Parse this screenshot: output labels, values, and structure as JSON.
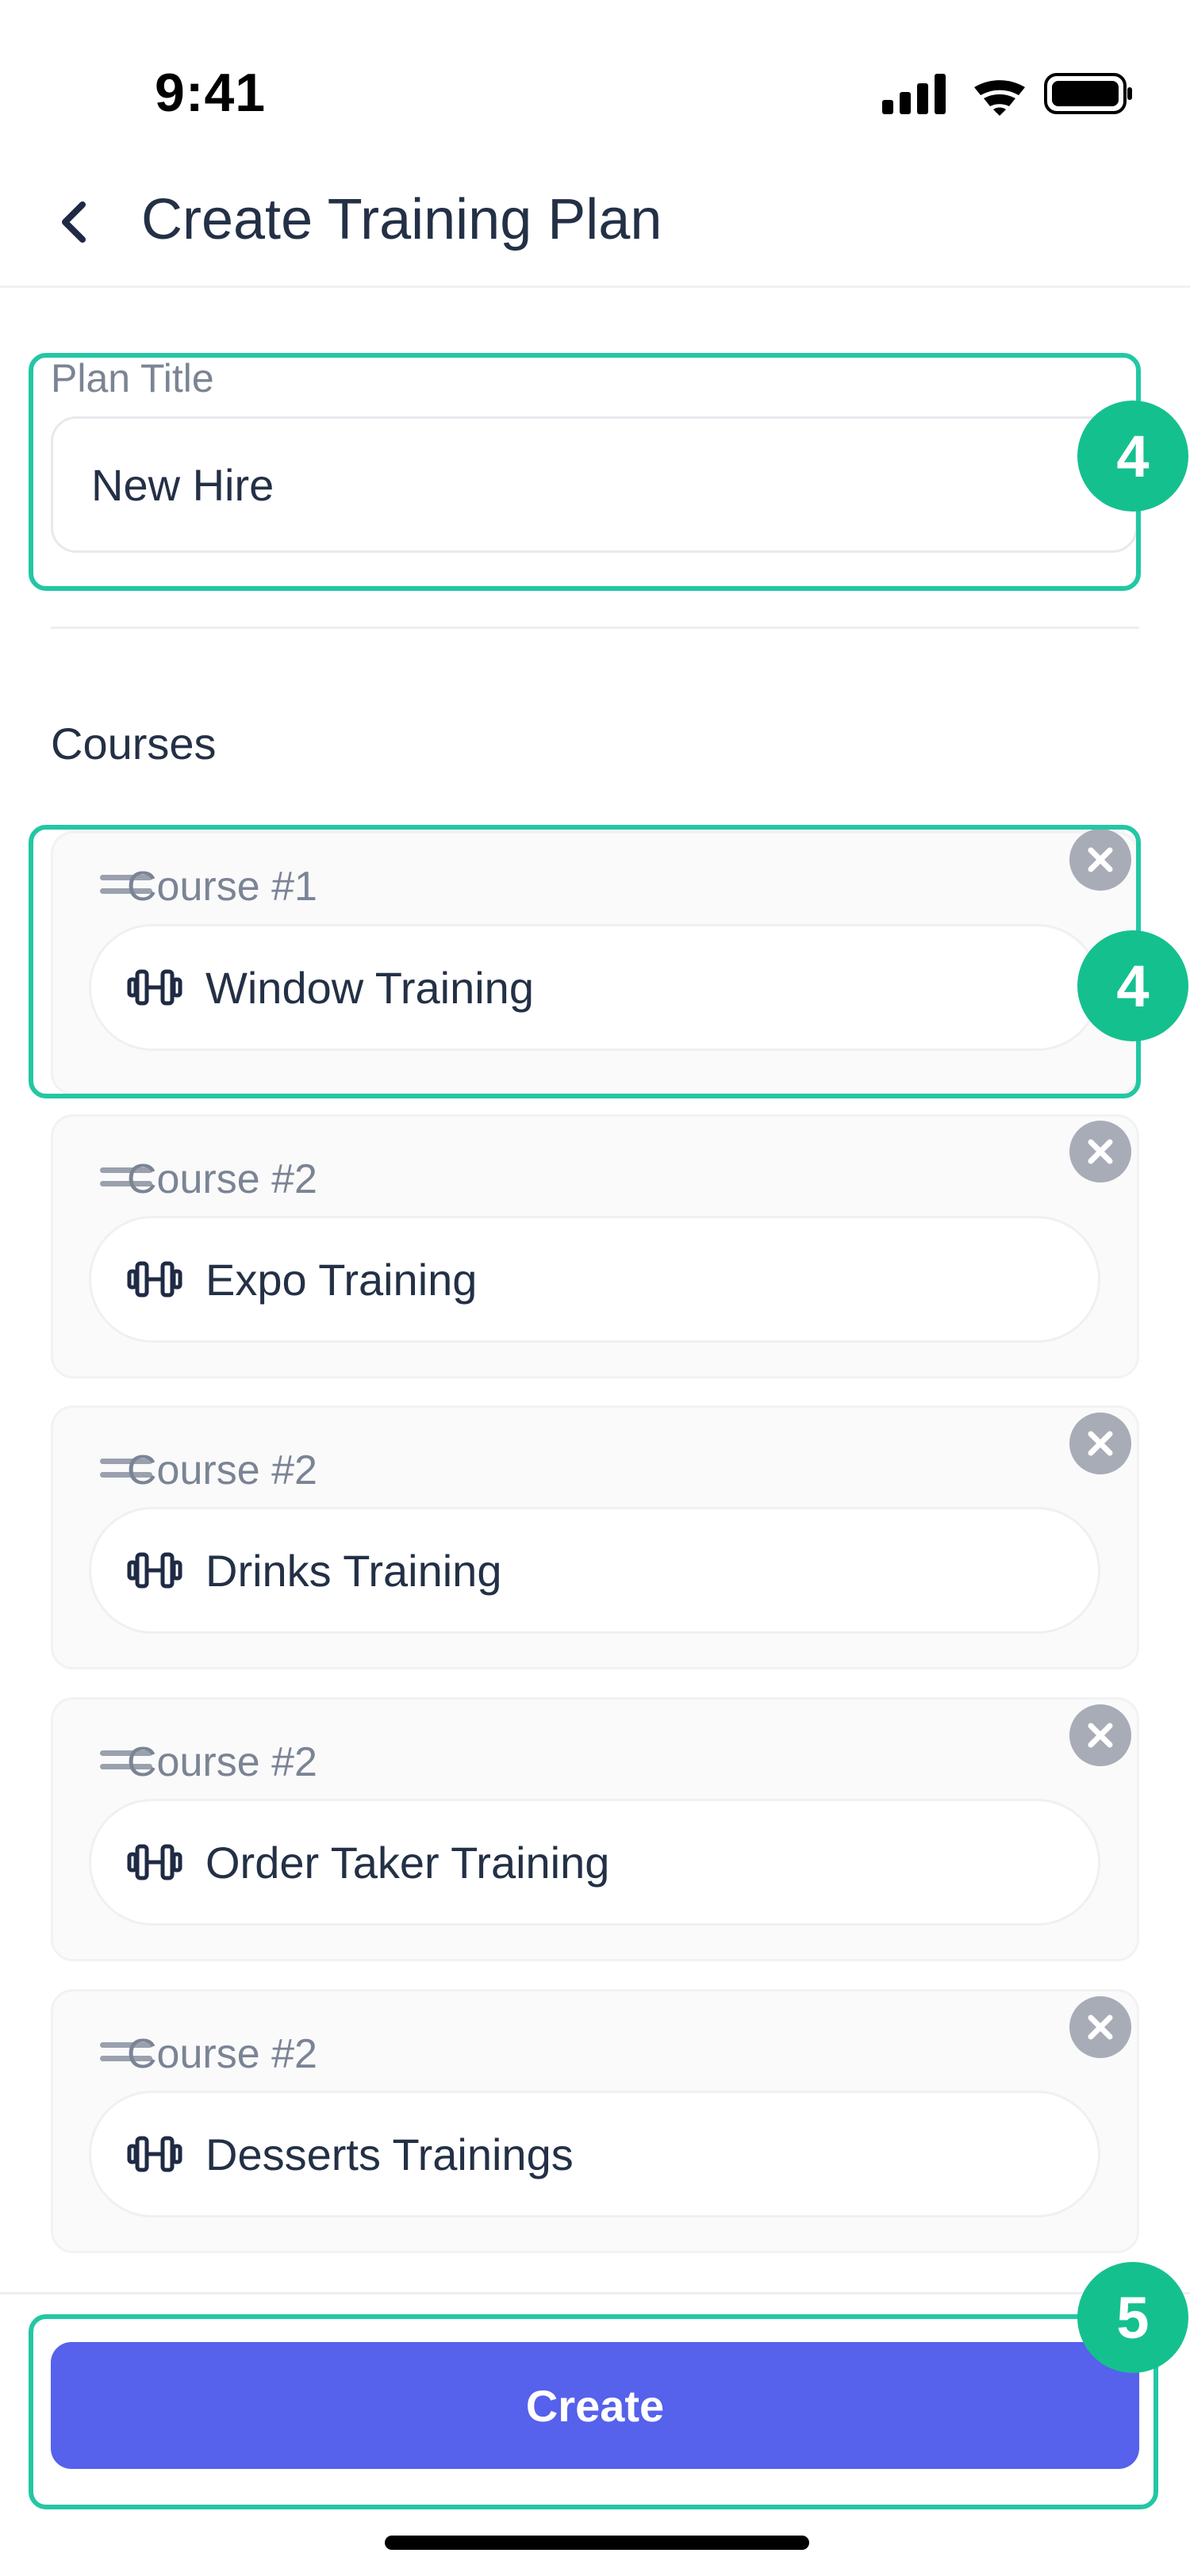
{
  "status_bar": {
    "time": "9:41"
  },
  "header": {
    "title": "Create Training Plan"
  },
  "plan": {
    "label": "Plan Title",
    "value": "New Hire"
  },
  "courses_section": {
    "title": "Courses"
  },
  "courses": [
    {
      "label": "Course #1",
      "name": "Window Training"
    },
    {
      "label": "Course #2",
      "name": "Expo Training"
    },
    {
      "label": "Course #2",
      "name": "Drinks Training"
    },
    {
      "label": "Course #2",
      "name": "Order Taker Training"
    },
    {
      "label": "Course #2",
      "name": "Desserts Trainings"
    }
  ],
  "footer": {
    "create_label": "Create"
  },
  "annotations": {
    "plan_badge": "4",
    "course_badge": "4",
    "create_badge": "5"
  },
  "icons": [
    "back-chevron-icon",
    "drag-handle-icon",
    "dumbbell-icon",
    "remove-icon",
    "signal-icon",
    "wifi-icon",
    "battery-icon"
  ],
  "colors": {
    "primary": "#5661ec",
    "highlight": "#23c7a4",
    "badge": "#15c08f",
    "remove": "#a7acb6"
  }
}
